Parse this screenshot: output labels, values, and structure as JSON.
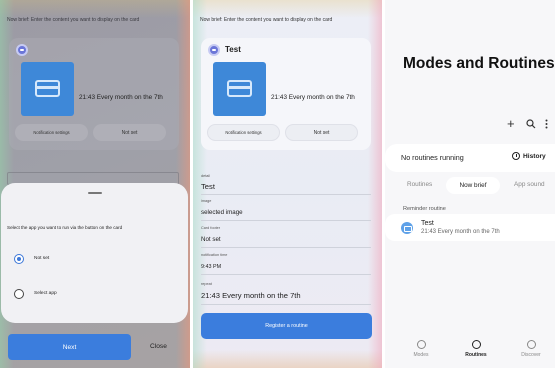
{
  "screen1": {
    "hint": "Now brief: Enter the content you want to display on the card",
    "card": {
      "time": "21:43 Every month on the 7th",
      "left_button": "Notification settings",
      "right_button": "Not set"
    },
    "sheet": {
      "question": "Select the app you want to run via the button on the card",
      "options": [
        {
          "label": "Not set",
          "selected": true
        },
        {
          "label": "Select app",
          "selected": false
        }
      ]
    },
    "next_label": "Next",
    "close_label": "Close",
    "accent": "#3b7ddd"
  },
  "screen2": {
    "hint": "Now brief: Enter the content you want to display on the card",
    "card": {
      "title": "Test",
      "time": "21:43 Every month on the 7th",
      "left_button": "Notification settings",
      "right_button": "Not set"
    },
    "fields": [
      {
        "label": "detail",
        "value": "Test"
      },
      {
        "label": "image",
        "value": "selected image"
      },
      {
        "label": "Card footer",
        "value": "Not set"
      },
      {
        "label": "notification time",
        "value": "9:43 PM"
      },
      {
        "label": "repeat",
        "value": "21:43 Every month on the 7th"
      }
    ],
    "register_label": "Register a routine"
  },
  "screen3": {
    "title": "Modes and Routines",
    "toolbar": {
      "add_icon": "plus-icon",
      "search_icon": "search-icon",
      "more_icon": "more-vertical-icon"
    },
    "status": {
      "text": "No routines running",
      "history_label": "History"
    },
    "tabs": [
      "Routines",
      "Now brief",
      "App sound"
    ],
    "active_tab": "Now brief",
    "reminder_label": "Reminder routine",
    "routine": {
      "title": "Test",
      "subtitle": "21:43 Every month on the 7th"
    },
    "nav": [
      "Modes",
      "Routines",
      "Discover"
    ],
    "active_nav": "Routines"
  }
}
